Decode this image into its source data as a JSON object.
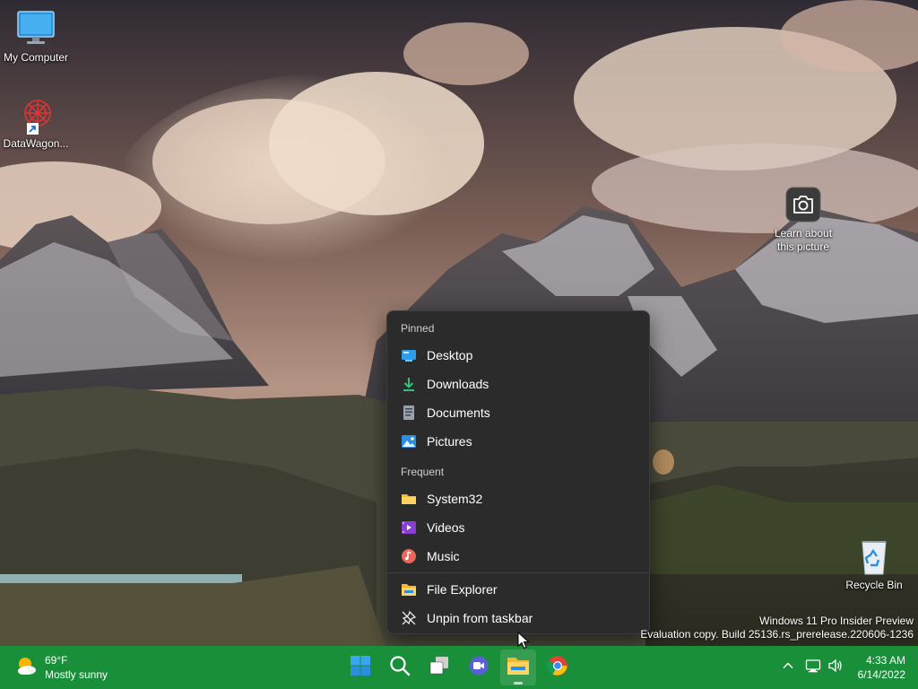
{
  "desktop": {
    "icons": [
      {
        "label": "My Computer",
        "icon": "monitor-icon"
      },
      {
        "label": "DataWagon...",
        "icon": "datawagon-shortcut-icon"
      },
      {
        "label": "Learn about this picture",
        "line1": "Learn about",
        "line2": "this picture",
        "icon": "camera-icon"
      },
      {
        "label": "Recycle Bin",
        "icon": "recycle-bin-icon"
      }
    ]
  },
  "jumplist": {
    "pinned_header": "Pinned",
    "pinned": [
      {
        "label": "Desktop",
        "icon": "desktop-folder-icon"
      },
      {
        "label": "Downloads",
        "icon": "downloads-icon"
      },
      {
        "label": "Documents",
        "icon": "documents-icon"
      },
      {
        "label": "Pictures",
        "icon": "pictures-icon"
      }
    ],
    "frequent_header": "Frequent",
    "frequent": [
      {
        "label": "System32",
        "icon": "folder-icon"
      },
      {
        "label": "Videos",
        "icon": "videos-icon"
      },
      {
        "label": "Music",
        "icon": "music-icon"
      }
    ],
    "actions": [
      {
        "label": "File Explorer",
        "icon": "file-explorer-icon"
      },
      {
        "label": "Unpin from taskbar",
        "icon": "unpin-icon"
      }
    ]
  },
  "watermark": {
    "line1": "Windows 11 Pro Insider Preview",
    "line2": "Evaluation copy. Build 25136.rs_prerelease.220606-1236"
  },
  "taskbar": {
    "weather": {
      "temp": "69°F",
      "condition": "Mostly sunny",
      "icon": "sun-cloud-icon"
    },
    "apps": [
      {
        "name": "Start",
        "icon": "windows-start-icon"
      },
      {
        "name": "Search",
        "icon": "search-icon"
      },
      {
        "name": "Task View",
        "icon": "task-view-icon"
      },
      {
        "name": "Chat",
        "icon": "chat-icon"
      },
      {
        "name": "File Explorer",
        "icon": "file-explorer-icon",
        "active": true
      },
      {
        "name": "Chrome",
        "icon": "chrome-icon"
      }
    ],
    "tray": [
      "chevron-up-icon",
      "network-icon",
      "volume-icon"
    ],
    "clock": {
      "time": "4:33 AM",
      "date": "6/14/2022"
    },
    "color": "#1a8f3a"
  }
}
